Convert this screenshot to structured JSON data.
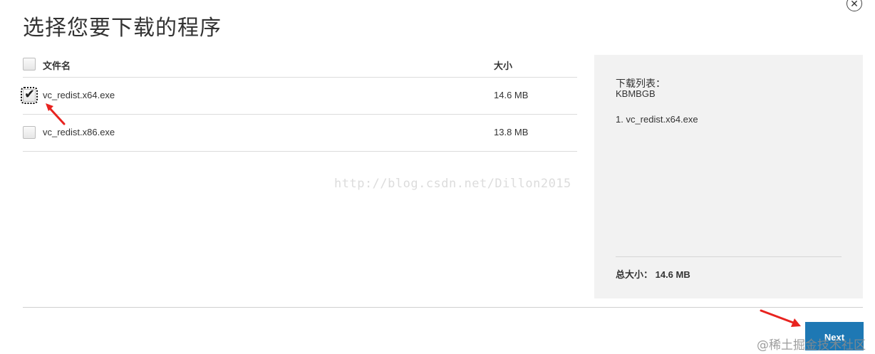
{
  "dialog": {
    "close_glyph": "✕",
    "title": "选择您要下载的程序"
  },
  "table": {
    "header": {
      "name_label": "文件名",
      "size_label": "大小"
    },
    "rows": [
      {
        "name": "vc_redist.x64.exe",
        "size": "14.6 MB",
        "checked": true
      },
      {
        "name": "vc_redist.x86.exe",
        "size": "13.8 MB",
        "checked": false
      }
    ]
  },
  "watermark": "http://blog.csdn.net/Dillon2015",
  "summary": {
    "title": "下载列表：",
    "code": "KBMBGB",
    "items": [
      "1. vc_redist.x64.exe"
    ],
    "total": "总大小： 14.6 MB"
  },
  "footer": {
    "next_label": "Next"
  },
  "corner_mark": "@稀土掘金技术社区",
  "colors": {
    "primary_button": "#1e78b4",
    "annotation_arrow": "#e8231f",
    "panel_bg": "#f2f2f2"
  },
  "icons": {
    "close": "close-icon",
    "check": "checkmark-icon",
    "annotation": "red-arrow-icon"
  }
}
